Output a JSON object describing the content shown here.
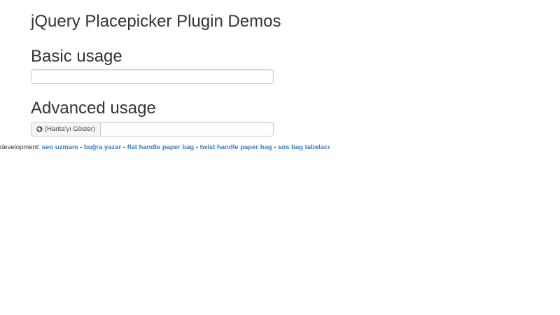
{
  "page": {
    "title": "jQuery Placepicker Plugin Demos"
  },
  "basic": {
    "heading": "Basic usage",
    "input_value": ""
  },
  "advanced": {
    "heading": "Advanced usage",
    "map_button_label": "(Harita'yı Göster)",
    "map_button_icon": "globe-icon",
    "input_value": ""
  },
  "footer": {
    "prefix": "development:",
    "links": [
      "seo uzmanı",
      "buğra yazar",
      "flat handle paper bag",
      "twist handle paper bag",
      "sos bag tabelacı"
    ],
    "separator": "-"
  },
  "colors": {
    "link": "#3a7bbf",
    "text": "#333333",
    "border": "#cccccc",
    "addon_background": "#f5f5f5"
  }
}
